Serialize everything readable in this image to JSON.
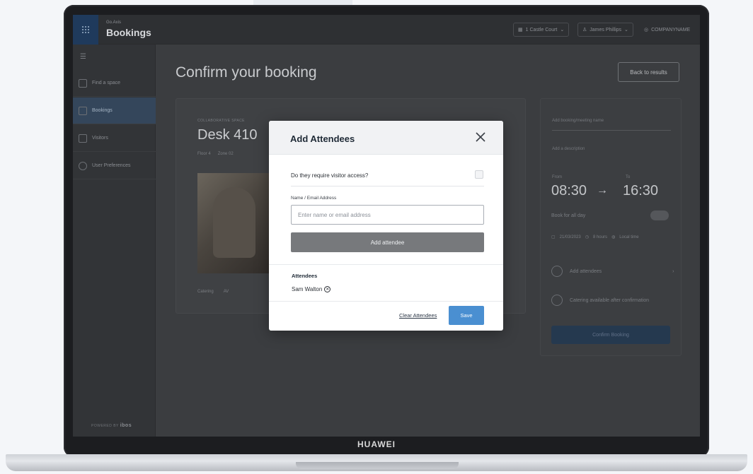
{
  "device": {
    "brand": "HUAWEI"
  },
  "app": {
    "org_label": "Go.Axis",
    "name": "Bookings"
  },
  "topbar": {
    "location": "1 Castle Court",
    "user": "James Phillips",
    "company": "COMPANYNAME"
  },
  "sidebar": {
    "items": [
      {
        "label": "Find a space",
        "icon": "binoculars-icon",
        "active": false
      },
      {
        "label": "Bookings",
        "icon": "calendar-icon",
        "active": true
      },
      {
        "label": "Visitors",
        "icon": "id-card-icon",
        "active": false
      },
      {
        "label": "User Preferences",
        "icon": "gear-icon",
        "active": false
      }
    ],
    "powered_by": "POWERED BY",
    "powered_brand": "ibos"
  },
  "page": {
    "title": "Confirm your booking",
    "back_button": "Back to results"
  },
  "space": {
    "type": "COLLABORATIVE SPACE",
    "name": "Desk 410",
    "floor": "Floor 4",
    "zone": "Zone 02",
    "amenities": [
      "Catering",
      "AV"
    ]
  },
  "booking_panel": {
    "name_placeholder": "Add booking/meeting name",
    "description_placeholder": "Add a description",
    "from_label": "From",
    "to_label": "To",
    "from_time": "08:30",
    "arrow": "→",
    "to_time": "16:30",
    "all_day_label": "Book for all day",
    "date": "21/03/2023",
    "duration": "8 hours",
    "timezone": "Local time",
    "attendees_link": "Add attendees",
    "catering_note": "Catering available after confirmation",
    "confirm_button": "Confirm Booking"
  },
  "modal": {
    "title": "Add Attendees",
    "visitor_question": "Do they require visitor access?",
    "visitor_checked": false,
    "name_label": "Name / Email Address",
    "name_placeholder": "Enter name or email address",
    "name_value": "",
    "add_button": "Add attendee",
    "attendees_heading": "Attendees",
    "attendees": [
      "Sam Walton"
    ],
    "clear_link": "Clear Attendees",
    "save_button": "Save"
  },
  "colors": {
    "primary": "#4a8fd1",
    "add_button": "#77797c",
    "overlay_dim": "#3b3d40"
  }
}
